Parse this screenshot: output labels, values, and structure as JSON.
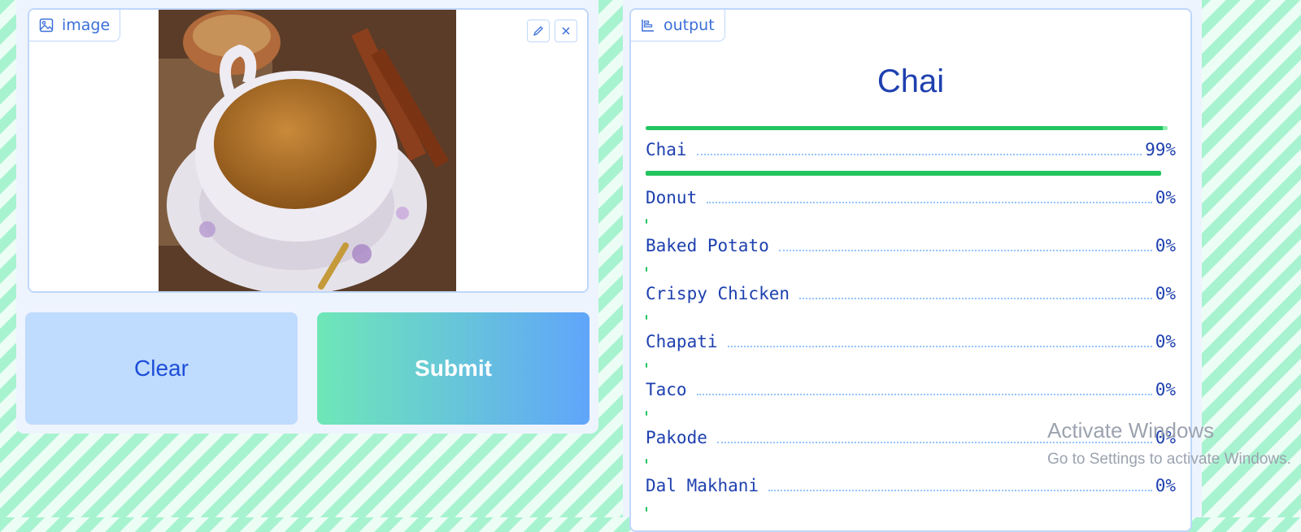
{
  "input_panel": {
    "label": "image",
    "label_icon": "image-icon",
    "edit_icon": "pencil-icon",
    "close_icon": "close-icon"
  },
  "buttons": {
    "clear": "Clear",
    "submit": "Submit"
  },
  "output_panel": {
    "label": "output",
    "label_icon": "bar-chart-icon",
    "top_label": "Chai",
    "top_confidence": 0.99,
    "predictions": [
      {
        "label": "Chai",
        "confidence": "99%",
        "value": 0.99
      },
      {
        "label": "Donut",
        "confidence": "0%",
        "value": 0.0
      },
      {
        "label": "Baked Potato",
        "confidence": "0%",
        "value": 0.0
      },
      {
        "label": "Crispy Chicken",
        "confidence": "0%",
        "value": 0.0
      },
      {
        "label": "Chapati",
        "confidence": "0%",
        "value": 0.0
      },
      {
        "label": "Taco",
        "confidence": "0%",
        "value": 0.0
      },
      {
        "label": "Pakode",
        "confidence": "0%",
        "value": 0.0
      },
      {
        "label": "Dal Makhani",
        "confidence": "0%",
        "value": 0.0
      }
    ]
  },
  "watermark": {
    "line1": "Activate Windows",
    "line2": "Go to Settings to activate Windows."
  },
  "colors": {
    "accent": "#1e40af",
    "bar": "#22c55e",
    "submit_gradient_start": "#6ee7b7",
    "submit_gradient_end": "#60a5fa"
  }
}
